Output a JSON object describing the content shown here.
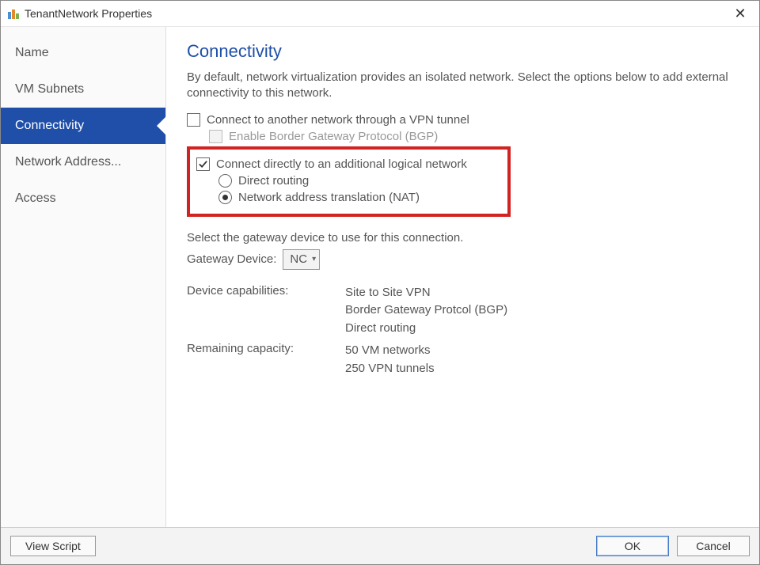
{
  "window": {
    "title": "TenantNetwork Properties"
  },
  "sidebar": {
    "items": [
      {
        "label": "Name"
      },
      {
        "label": "VM Subnets"
      },
      {
        "label": "Connectivity"
      },
      {
        "label": "Network Address..."
      },
      {
        "label": "Access"
      }
    ],
    "selected_index": 2
  },
  "page": {
    "heading": "Connectivity",
    "intro": "By default, network virtualization provides an isolated network. Select the options below to add external connectivity to this network.",
    "vpn_option": {
      "label": "Connect to another network through a VPN tunnel",
      "checked": false,
      "bgp": {
        "label": "Enable Border Gateway Protocol (BGP)",
        "checked": false,
        "enabled": false
      }
    },
    "direct_option": {
      "label": "Connect directly to an additional logical network",
      "checked": true,
      "radios": {
        "direct_routing": {
          "label": "Direct routing",
          "selected": false
        },
        "nat": {
          "label": "Network address translation (NAT)",
          "selected": true
        }
      }
    },
    "gateway": {
      "instruction": "Select the gateway device to use for this connection.",
      "label": "Gateway Device:",
      "selected": "NC"
    },
    "capabilities": {
      "label": "Device capabilities:",
      "lines": [
        "Site to Site VPN",
        "Border Gateway Protcol (BGP)",
        "Direct routing"
      ]
    },
    "capacity": {
      "label": "Remaining capacity:",
      "lines": [
        "50 VM networks",
        "250 VPN tunnels"
      ]
    }
  },
  "footer": {
    "view_script": "View Script",
    "ok": "OK",
    "cancel": "Cancel"
  }
}
